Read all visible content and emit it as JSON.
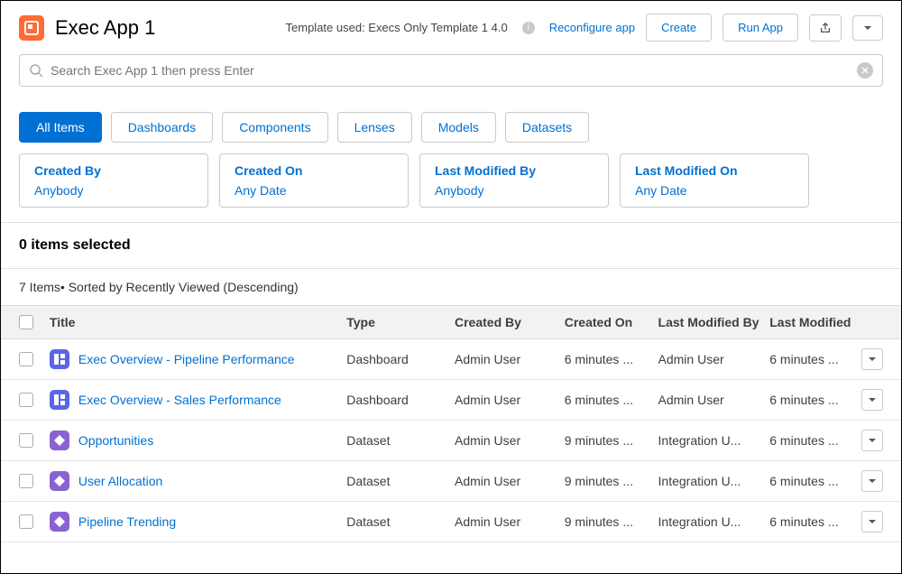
{
  "header": {
    "title": "Exec App 1",
    "template_label": "Template used: Execs Only Template 1 4.0",
    "reconfigure": "Reconfigure app",
    "create": "Create",
    "run": "Run App"
  },
  "search": {
    "placeholder": "Search Exec App 1 then press Enter"
  },
  "tabs": {
    "all": "All Items",
    "dashboards": "Dashboards",
    "components": "Components",
    "lenses": "Lenses",
    "models": "Models",
    "datasets": "Datasets"
  },
  "filters": {
    "created_by": {
      "label": "Created By",
      "value": "Anybody"
    },
    "created_on": {
      "label": "Created On",
      "value": "Any Date"
    },
    "last_modified_by": {
      "label": "Last Modified By",
      "value": "Anybody"
    },
    "last_modified_on": {
      "label": "Last Modified On",
      "value": "Any Date"
    }
  },
  "selection": "0 items selected",
  "sort_info": "7 Items• Sorted by Recently Viewed (Descending)",
  "columns": {
    "title": "Title",
    "type": "Type",
    "created_by": "Created By",
    "created_on": "Created On",
    "last_modified_by": "Last Modified By",
    "last_modified_on": "Last Modified"
  },
  "rows": [
    {
      "icon": "dashboard",
      "title": "Exec Overview - Pipeline Performance",
      "type": "Dashboard",
      "created_by": "Admin User",
      "created_on": "6 minutes ...",
      "last_modified_by": "Admin User",
      "last_modified_on": "6 minutes ..."
    },
    {
      "icon": "dashboard",
      "title": "Exec Overview - Sales Performance",
      "type": "Dashboard",
      "created_by": "Admin User",
      "created_on": "6 minutes ...",
      "last_modified_by": "Admin User",
      "last_modified_on": "6 minutes ..."
    },
    {
      "icon": "dataset",
      "title": "Opportunities",
      "type": "Dataset",
      "created_by": "Admin User",
      "created_on": "9 minutes ...",
      "last_modified_by": "Integration U...",
      "last_modified_on": "6 minutes ..."
    },
    {
      "icon": "dataset",
      "title": "User Allocation",
      "type": "Dataset",
      "created_by": "Admin User",
      "created_on": "9 minutes ...",
      "last_modified_by": "Integration U...",
      "last_modified_on": "6 minutes ..."
    },
    {
      "icon": "dataset",
      "title": "Pipeline Trending",
      "type": "Dataset",
      "created_by": "Admin User",
      "created_on": "9 minutes ...",
      "last_modified_by": "Integration U...",
      "last_modified_on": "6 minutes ..."
    }
  ]
}
